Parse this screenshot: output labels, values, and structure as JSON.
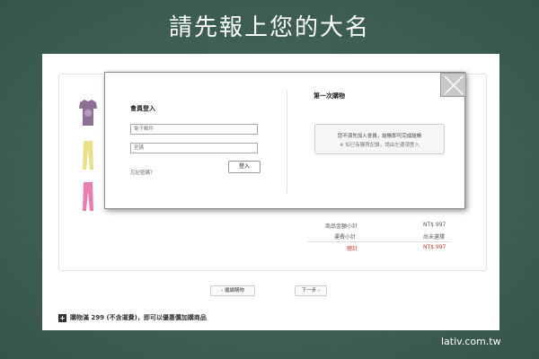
{
  "slide": {
    "title": "請先報上您的大名"
  },
  "modal": {
    "login_title": "會員登入",
    "email_placeholder": "電子郵件",
    "password_placeholder": "密碼",
    "forgot_label": "忘記密碼？",
    "login_button": "登入",
    "first_purchase_title": "第一次購物",
    "guest_line1": "您不須先加入會員，結帳即可完成結帳",
    "guest_line2": "※ 如已有購買記錄，請由左邊項登入"
  },
  "summary": {
    "rows": [
      {
        "label": "商品金額小計",
        "value": "NT$ 997"
      },
      {
        "label": "運費小計",
        "value": "尚未選擇"
      },
      {
        "label": "總計",
        "value": "NT$ 997"
      }
    ]
  },
  "nav": {
    "back_label": "‹ 繼續購物",
    "next_label": "下一步 ›"
  },
  "promo": {
    "text": "購物滿 299 (不含運費)，即可以優惠價加購商品"
  },
  "watermark": "lativ.com.tw",
  "colors": {
    "total": "#c0392b",
    "background": "#3d5e56"
  }
}
